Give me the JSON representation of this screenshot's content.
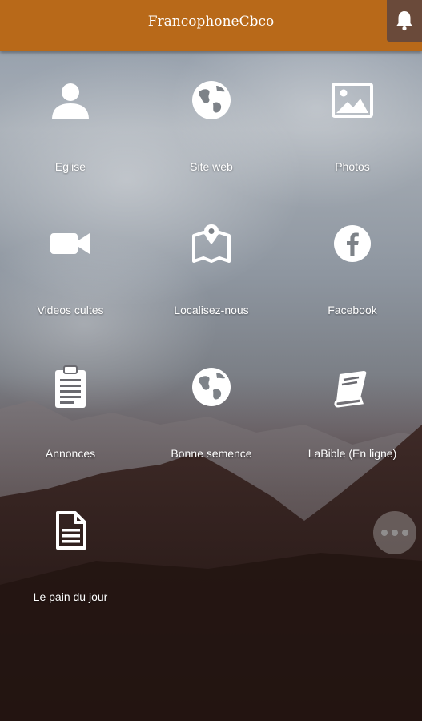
{
  "app": {
    "title": "FrancophoneCbco"
  },
  "header": {
    "notification_icon": "bell-icon"
  },
  "grid": [
    {
      "label": "Eglise",
      "icon": "user-icon"
    },
    {
      "label": "Site web",
      "icon": "globe-icon"
    },
    {
      "label": "Photos",
      "icon": "image-icon"
    },
    {
      "label": "Videos cultes",
      "icon": "video-camera-icon"
    },
    {
      "label": "Localisez-nous",
      "icon": "map-pin-icon"
    },
    {
      "label": "Facebook",
      "icon": "facebook-icon"
    },
    {
      "label": "Annonces",
      "icon": "clipboard-icon"
    },
    {
      "label": "Bonne semence",
      "icon": "globe-icon"
    },
    {
      "label": "LaBible (En ligne)",
      "icon": "book-icon"
    },
    {
      "label": "Le pain du jour",
      "icon": "document-icon"
    }
  ],
  "fab": {
    "icon": "more-dots-icon"
  },
  "colors": {
    "accent": "#b86919",
    "text": "#ffffff"
  }
}
